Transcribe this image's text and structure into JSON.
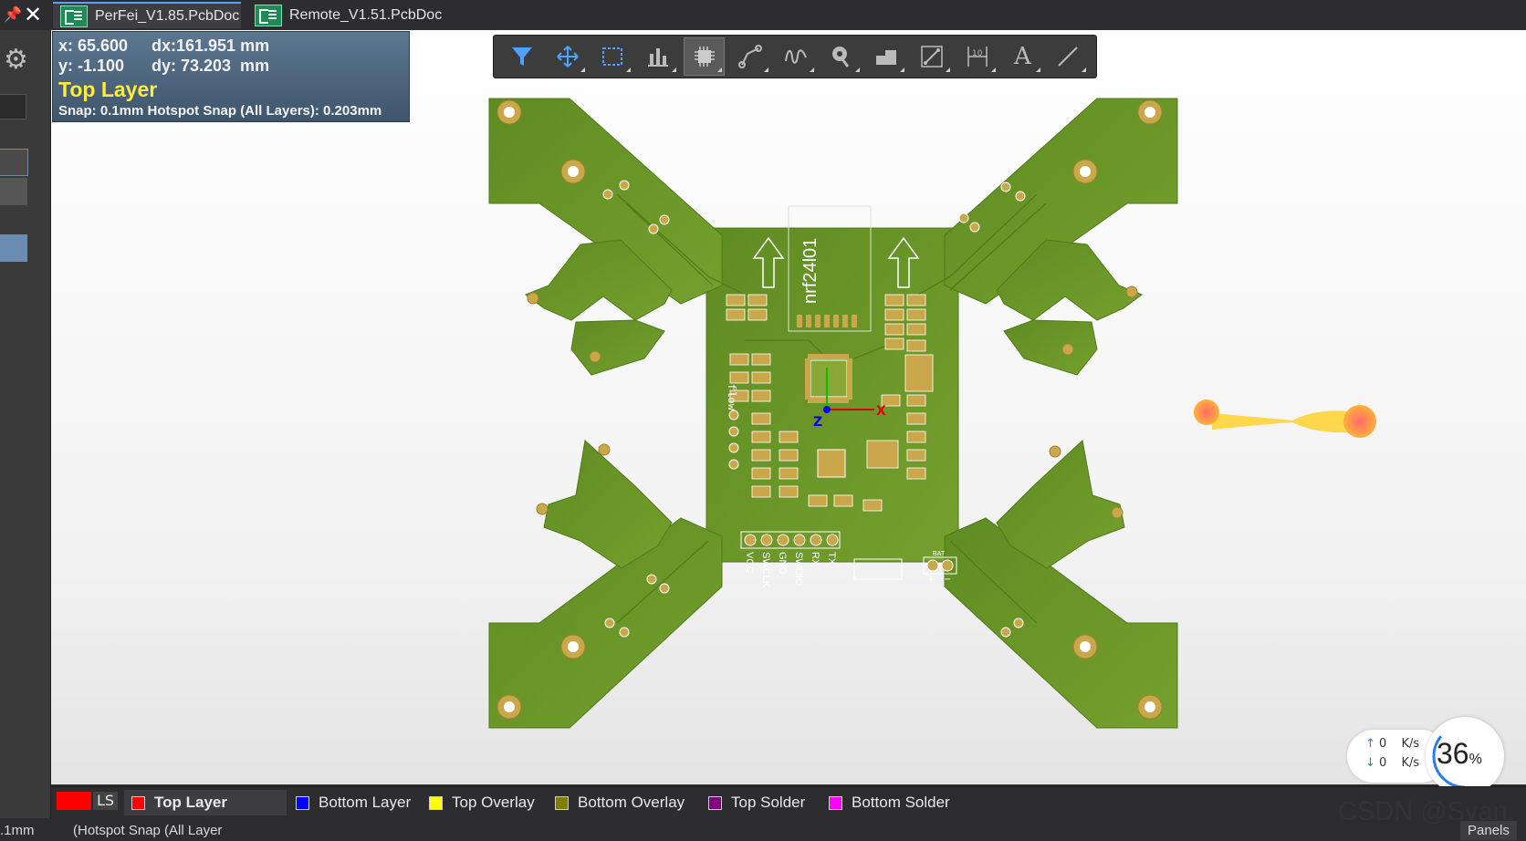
{
  "tabs": [
    {
      "label": "PerFei_V1.85.PcbDoc",
      "active": true
    },
    {
      "label": "Remote_V1.51.PcbDoc",
      "active": false
    }
  ],
  "hud": {
    "x": "x: 65.600",
    "dx": "dx:161.951 mm",
    "y": "y: -1.100",
    "dy": "dy: 73.203  mm",
    "layer": "Top Layer",
    "snap": "Snap: 0.1mm Hotspot Snap (All Layers): 0.203mm"
  },
  "toolbar": {
    "items": [
      "filter-icon",
      "move-icon",
      "select-rect-icon",
      "align-icon",
      "component-icon",
      "route-icon",
      "interactive-tune-icon",
      "via-icon",
      "polygon-icon",
      "track-icon",
      "dimension-icon",
      "text-icon",
      "line-icon"
    ],
    "text_glyph": "A"
  },
  "board": {
    "module_label": "nrf24l01",
    "side_label": "flow",
    "header_pins": [
      "VCC",
      "SWCLK",
      "GND",
      "SWDIO",
      "RX",
      "TX"
    ],
    "bat_label": "BAT",
    "bat_plus": "+",
    "bat_minus": "−",
    "axis_x": "X",
    "axis_z": "Z",
    "board_color": "#6f9a2a",
    "copper_color": "#c9a74a"
  },
  "layers": {
    "ls_label": "LS",
    "items": [
      {
        "label": "Top Layer",
        "color": "#ff0000",
        "active": true
      },
      {
        "label": "Bottom Layer",
        "color": "#0000ff",
        "active": false
      },
      {
        "label": "Top Overlay",
        "color": "#ffff00",
        "active": false
      },
      {
        "label": "Bottom Overlay",
        "color": "#808000",
        "active": false
      },
      {
        "label": "Top Solder",
        "color": "#800080",
        "active": false
      },
      {
        "label": "Bottom Solder",
        "color": "#ff00ff",
        "active": false
      }
    ]
  },
  "status": {
    "left": ".1mm",
    "middle": "(Hotspot Snap (All Layer",
    "panels": "Panels"
  },
  "net": {
    "up": "0",
    "down": "0",
    "unit": "K/s",
    "cpu": "36",
    "cpu_unit": "%"
  },
  "watermark": "CSDN @Svan."
}
